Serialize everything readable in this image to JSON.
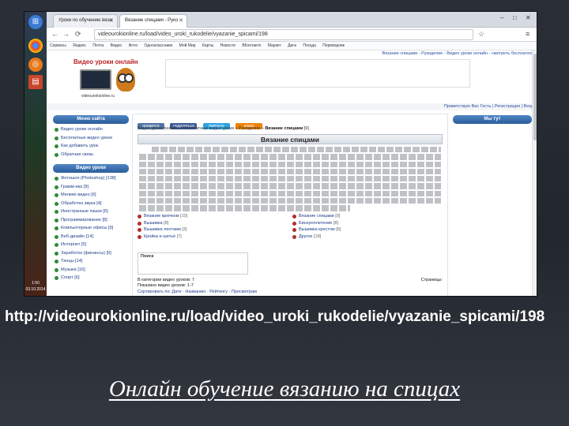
{
  "browser": {
    "tabs": [
      {
        "label": "Уроки по обучению вяза"
      },
      {
        "label": "Вязание спицами - Руко"
      }
    ],
    "address": "videourokionline.ru/load/video_uroki_rukodelie/vyazanie_spicami/198",
    "bookmarks": [
      "Сервисы",
      "Яндекс",
      "Почта",
      "Видео",
      "Фото",
      "Одноклассники",
      "Мой Мир",
      "Карты",
      "Новости",
      "ВКонтакте",
      "Маркет",
      "Диск",
      "Погода",
      "Переводчик"
    ]
  },
  "site": {
    "topbar_text": "Вязание спицами - Рукоделие - Видео уроки онлайн - смотреть бесплатно!",
    "logo_title": "Видео уроки онлайн",
    "logo_url": "videourokionline.ru",
    "userbar_text": "Приветствую Вас Гость | Регистрация | Вход",
    "left_menu": {
      "header1": "Меню сайта",
      "items1": [
        "Видео уроки онлайн",
        "Бесплатные видео уроки",
        "Как добавить урок",
        "Обратная связь"
      ],
      "header2": "Видео уроки",
      "items2": [
        "Фотошоп (Photoshop) [138]",
        "Грамм-ика [9]",
        "Мелкие видео [6]",
        "Обработка звука [4]",
        "Иностранные языки [6]",
        "Программирование [8]",
        "Компьютерные офисы [9]",
        "Веб-дизайн [14]",
        "Интернет [5]",
        "Заработок (финансы) [9]",
        "Танцы [14]",
        "Музыка [16]",
        "Спорт [6]"
      ]
    },
    "share_buttons": [
      "нравится",
      "поделиться",
      "твитнуть",
      "класс"
    ],
    "breadcrumb": [
      "Видео уроки онлайн",
      "Бесплатные видео уроки",
      "Рукоделие",
      "Вязание спицами"
    ],
    "breadcrumb_count": "[9]",
    "page_title": "Вязание спицами",
    "categories_left": [
      {
        "name": "Вязание крючком",
        "count": "[10]"
      },
      {
        "name": "Вышивка",
        "count": "[8]"
      },
      {
        "name": "Вышивка лентами",
        "count": "[3]"
      },
      {
        "name": "Кройка и шитьё",
        "count": "[7]"
      }
    ],
    "categories_right": [
      {
        "name": "Вязание спицами",
        "count": "[9]"
      },
      {
        "name": "Бисероплетение",
        "count": "[8]"
      },
      {
        "name": "Вышивка крестом",
        "count": "[6]"
      },
      {
        "name": "Другое",
        "count": "[18]"
      }
    ],
    "search_label": "Поиск",
    "stats_line1": "В категории видео уроков: 7",
    "stats_line2": "Показано видео уроков: 1-7",
    "pages_label": "Страницы:",
    "footer_breadcrumb": "Сортировать по: Дате · Названию · Рейтингу · Просмотрам",
    "right_header": "Мы тут"
  },
  "taskbar": {
    "clock": "1:50",
    "date": "03.10.2014"
  },
  "caption": {
    "url": "http://videourokionline.ru/load/video_uroki_rukodelie/vyazanie_spicami/198",
    "title": "Онлайн обучение вязанию на спицах"
  }
}
